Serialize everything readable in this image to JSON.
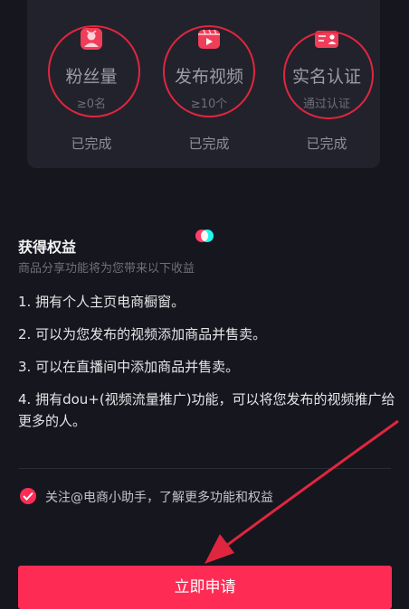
{
  "requirements": [
    {
      "title": "粉丝量",
      "sub": "≥0名",
      "status": "已完成",
      "icon": "fans-icon"
    },
    {
      "title": "发布视频",
      "sub": "≥10个",
      "status": "已完成",
      "icon": "video-icon"
    },
    {
      "title": "实名认证",
      "sub": "通过认证",
      "status": "已完成",
      "icon": "id-card-icon"
    }
  ],
  "benefits": {
    "title": "获得权益",
    "subtitle": "商品分享功能将为您带来以下收益",
    "items": [
      "1. 拥有个人主页电商橱窗。",
      "2. 可以为您发布的视频添加商品并售卖。",
      "3. 可以在直播间中添加商品并售卖。",
      "4. 拥有dou+(视频流量推广)功能，可以将您发布的视频推广给更多的人。"
    ]
  },
  "agreement": {
    "text": "关注@电商小助手，了解更多功能和权益",
    "checked": true
  },
  "apply_button": {
    "label": "立即申请"
  },
  "colors": {
    "accent": "#fe2c55",
    "annotation": "#e0263f",
    "background": "#16161e",
    "card": "#22222c"
  }
}
